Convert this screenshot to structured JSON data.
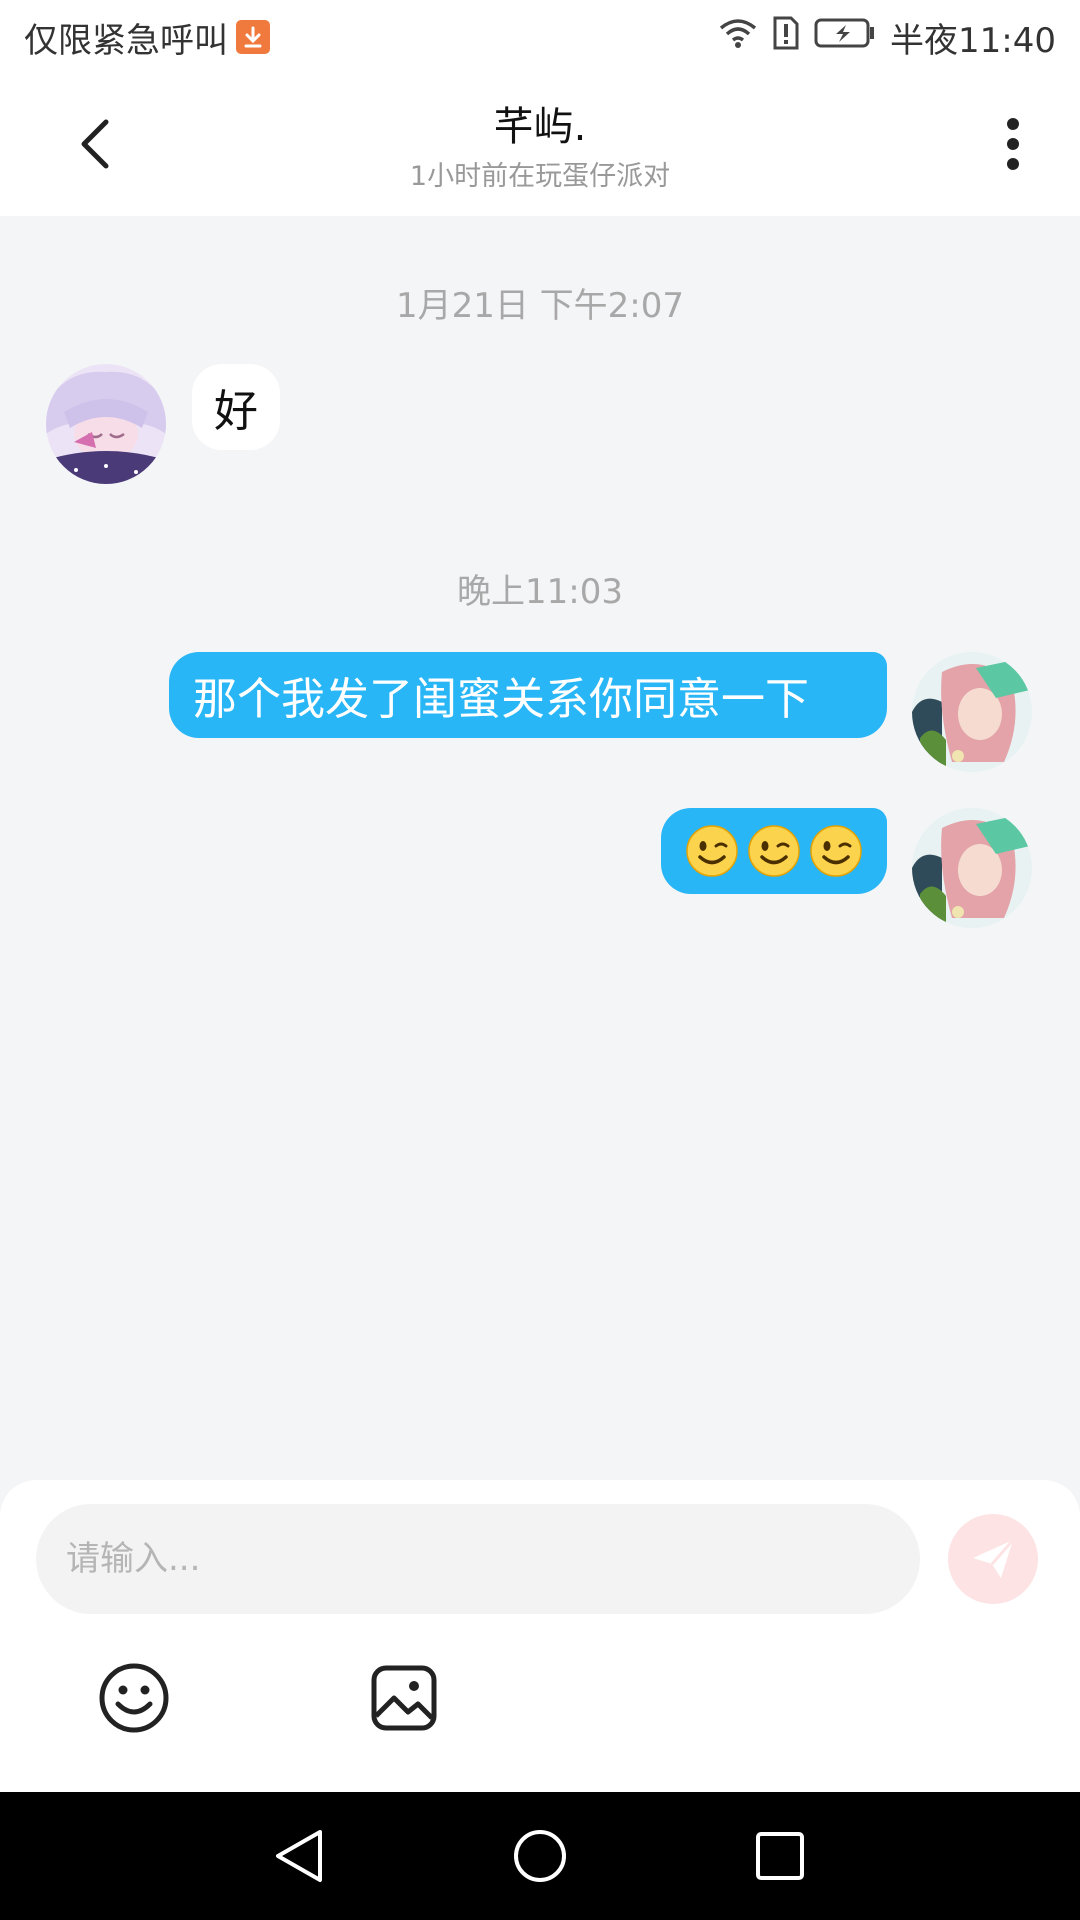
{
  "status_bar": {
    "left_text": "仅限紧急呼叫",
    "time": "半夜11:40",
    "icons": [
      "download-icon",
      "wifi-icon",
      "sim-alert-icon",
      "battery-charging-icon"
    ]
  },
  "header": {
    "title": "芊屿.",
    "subtitle": "1小时前在玩蛋仔派对",
    "icons": [
      "back-arrow-icon",
      "more-vertical-icon"
    ]
  },
  "chat": {
    "timestamp_1": "1月21日 下午2:07",
    "incoming_message": "好",
    "timestamp_2": "晚上11:03",
    "outgoing_message_1": "那个我发了闺蜜关系你同意一下",
    "outgoing_message_2_emojis": [
      "winking-face",
      "winking-face",
      "winking-face"
    ]
  },
  "composer": {
    "placeholder": "请输入...",
    "icons": [
      "send-icon",
      "emoji-icon",
      "image-icon"
    ]
  },
  "nav_bar": {
    "icons": [
      "nav-back-icon",
      "nav-home-icon",
      "nav-recents-icon"
    ]
  },
  "colors": {
    "outgoing_bubble": "#29b6f6",
    "incoming_bubble": "#ffffff",
    "chat_background": "#f4f5f7",
    "send_button": "#fde3e3",
    "download_badge": "#f07a3e"
  }
}
